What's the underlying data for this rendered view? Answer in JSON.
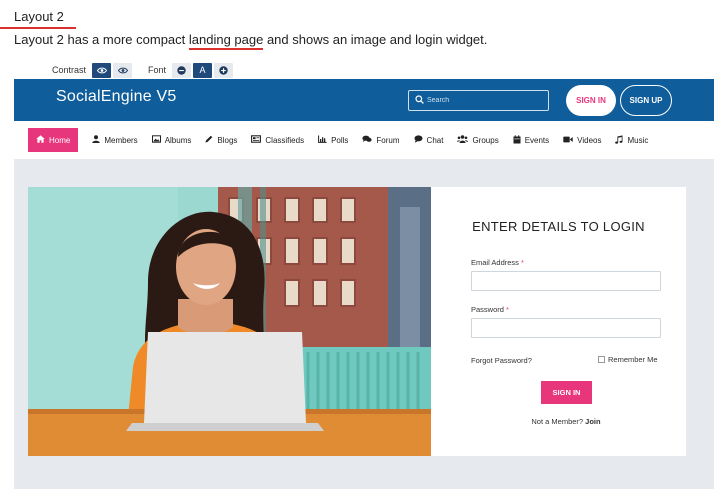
{
  "doc": {
    "heading": "Layout 2",
    "desc_before": "Layout 2 has a more compact ",
    "desc_link": "landing page",
    "desc_after": " and shows an image and login widget."
  },
  "accessibility": {
    "contrast_label": "Contrast",
    "font_label": "Font",
    "contrast_icon_dark": "eye-icon",
    "contrast_icon_light": "eye-icon",
    "font_minus": "minus-icon",
    "font_a": "A",
    "font_plus": "plus-icon"
  },
  "header": {
    "logo": "SocialEngine V5",
    "search_placeholder": "Search",
    "signin": "SIGN IN",
    "signup": "SIGN UP",
    "colors": {
      "bar": "#0f5d9a",
      "accent": "#e8367d"
    }
  },
  "nav": {
    "items": [
      {
        "label": "Home",
        "icon": "home-icon",
        "active": true
      },
      {
        "label": "Members",
        "icon": "user-icon"
      },
      {
        "label": "Albums",
        "icon": "image-icon"
      },
      {
        "label": "Blogs",
        "icon": "pencil-icon"
      },
      {
        "label": "Classifieds",
        "icon": "newspaper-icon"
      },
      {
        "label": "Polls",
        "icon": "chart-icon"
      },
      {
        "label": "Forum",
        "icon": "comments-icon"
      },
      {
        "label": "Chat",
        "icon": "chat-icon"
      },
      {
        "label": "Groups",
        "icon": "users-icon"
      },
      {
        "label": "Events",
        "icon": "calendar-icon"
      },
      {
        "label": "Videos",
        "icon": "video-icon"
      },
      {
        "label": "Music",
        "icon": "music-icon"
      }
    ]
  },
  "login": {
    "title": "ENTER DETAILS TO LOGIN",
    "email_label": "Email Address",
    "password_label": "Password",
    "required_mark": "*",
    "forgot": "Forgot Password?",
    "remember": "Remember Me",
    "submit": "SIGN IN",
    "not_member": "Not a Member?",
    "join": "Join"
  }
}
